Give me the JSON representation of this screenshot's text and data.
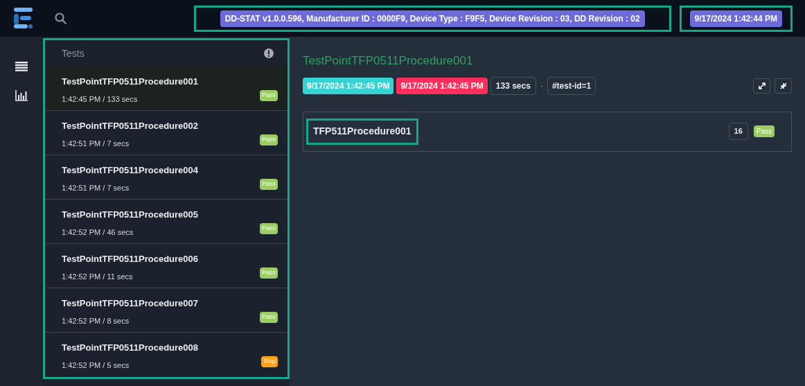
{
  "header": {
    "device_info": {
      "text": "DD-STAT v1.0.0.596, Manufacturer ID : 0000F9, Device Type : F9F5, Device Revision : 03, DD Revision : 02",
      "highlighted": true
    },
    "date": {
      "text": "9/17/2024 1:42:44 PM",
      "highlighted": true
    }
  },
  "test_list": {
    "title": "Tests",
    "highlighted": true,
    "items": [
      {
        "name": "TestPointTFP0511Procedure001",
        "meta": "1:42:45 PM / 133 secs",
        "status": "Pass",
        "color": "#9ccc65",
        "selected": true
      },
      {
        "name": "TestPointTFP0511Procedure002",
        "meta": "1:42:51 PM / 7 secs",
        "status": "Pass",
        "color": "#9ccc65",
        "selected": false
      },
      {
        "name": "TestPointTFP0511Procedure004",
        "meta": "1:42:51 PM / 7 secs",
        "status": "Pass",
        "color": "#9ccc65",
        "selected": false
      },
      {
        "name": "TestPointTFP0511Procedure005",
        "meta": "1:42:52 PM / 46 secs",
        "status": "Pass",
        "color": "#9ccc65",
        "selected": false
      },
      {
        "name": "TestPointTFP0511Procedure006",
        "meta": "1:42:52 PM / 11 secs",
        "status": "Pass",
        "color": "#9ccc65",
        "selected": false
      },
      {
        "name": "TestPointTFP0511Procedure007",
        "meta": "1:42:52 PM / 8 secs",
        "status": "Pass",
        "color": "#9ccc65",
        "selected": false
      },
      {
        "name": "TestPointTFP0511Procedure008",
        "meta": "1:42:52 PM / 5 secs",
        "status": "Skip",
        "color": "#ff9f1a",
        "selected": false
      }
    ]
  },
  "detail": {
    "title": "TestPointTFP0511Procedure001",
    "start": "9/17/2024 1:42:45 PM",
    "end": "9/17/2024 1:42:45 PM",
    "duration": "133 secs",
    "separator": "·",
    "test_id": "#test-id=1",
    "node": {
      "name": "TFP511Procedure001",
      "highlighted": true,
      "count": "16",
      "status": "Pass",
      "color": "#9ccc65"
    }
  }
}
